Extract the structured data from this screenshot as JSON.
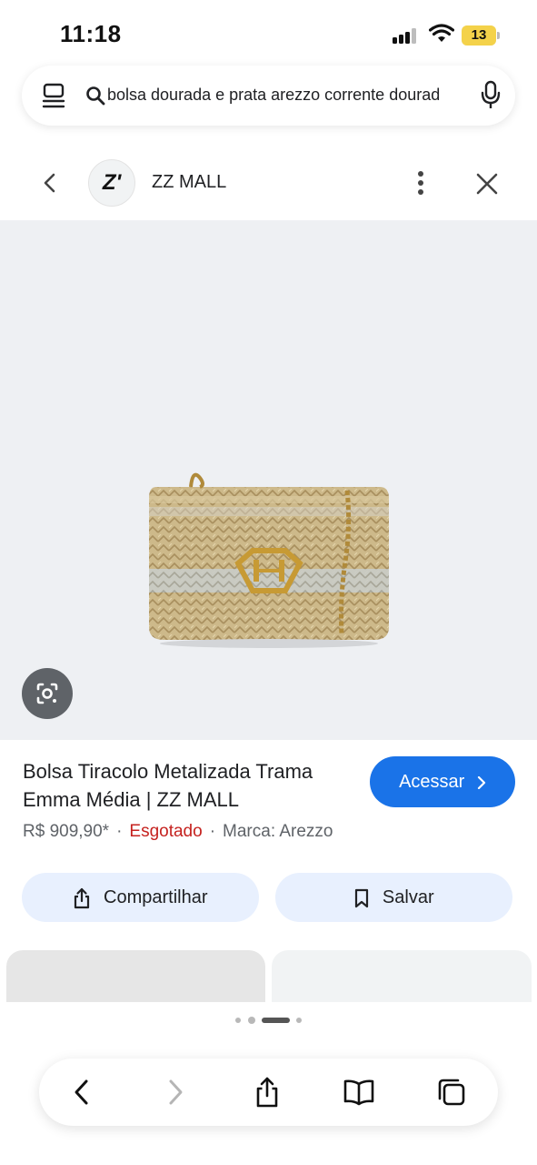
{
  "status_bar": {
    "time": "11:18",
    "battery_level": "13",
    "battery_color": "#f4d24a"
  },
  "search": {
    "query": "bolsa dourada e prata arezzo corrente dourad"
  },
  "source": {
    "logo_text": "Z'",
    "name": "ZZ MALL"
  },
  "product": {
    "title": "Bolsa Tiracolo Metalizada Trama Emma Média | ZZ MALL",
    "price": "R$ 909,90*",
    "stock_status": "Esgotado",
    "brand": "Marca: Arezzo",
    "separator": "·",
    "image_alt": "bag-image"
  },
  "buttons": {
    "access": "Acessar",
    "share": "Compartilhar",
    "save": "Salvar"
  },
  "colors": {
    "accent": "#1a73e8",
    "out_of_stock": "#c5221f",
    "chip_bg": "#e8f0fe"
  },
  "icons": {
    "tabs": "tabs-icon",
    "search": "search-icon",
    "mic": "mic-icon",
    "back": "chevron-left-icon",
    "more": "more-vertical-icon",
    "close": "close-icon",
    "lens": "google-lens-icon",
    "share": "share-icon",
    "bookmark": "bookmark-icon",
    "book": "bookmarks-book-icon",
    "tabs_overview": "tabs-overview-icon"
  }
}
